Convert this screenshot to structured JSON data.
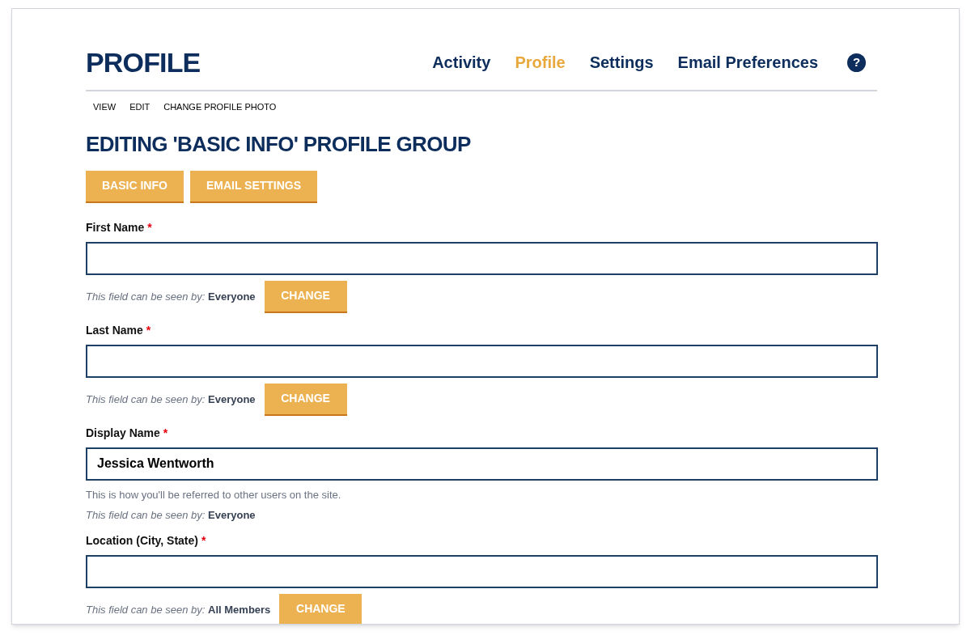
{
  "header": {
    "title": "PROFILE",
    "nav": [
      {
        "label": "Activity",
        "selected": false
      },
      {
        "label": "Profile",
        "selected": true
      },
      {
        "label": "Settings",
        "selected": false
      },
      {
        "label": "Email Preferences",
        "selected": false
      }
    ],
    "help_icon": "?"
  },
  "subnav": [
    {
      "label": "VIEW"
    },
    {
      "label": "EDIT"
    },
    {
      "label": "CHANGE PROFILE PHOTO"
    }
  ],
  "heading": "EDITING 'BASIC INFO' PROFILE GROUP",
  "group_tabs": [
    {
      "label": "BASIC INFO"
    },
    {
      "label": "EMAIL SETTINGS"
    }
  ],
  "fields": [
    {
      "label": "First Name",
      "required_mark": "*",
      "visibility": "*This field can be seen by:* **Everyone**",
      "change_button": "CHANGE"
    },
    {
      "label": "Last Name",
      "required_mark": "*",
      "visibility": "*This field can be seen by:* **Everyone**",
      "change_button": "CHANGE"
    },
    {
      "label": "Display Name",
      "required_mark": "*",
      "value": "Jessica Wentworth",
      "description": "This is how you'll be referred to other users on the site.",
      "visibility": "*This field can be seen by:* **Everyone**"
    },
    {
      "label": "Location (City, State)",
      "required_mark": "*",
      "visibility": "*This field can be seen by:* **All Members**",
      "change_button": "CHANGE"
    }
  ]
}
